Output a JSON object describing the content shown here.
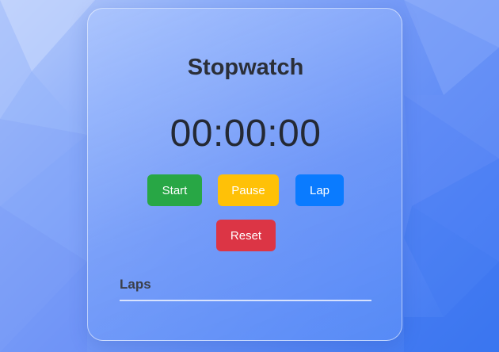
{
  "stopwatch": {
    "title": "Stopwatch",
    "time": "00:00:00"
  },
  "controls": {
    "start_label": "Start",
    "pause_label": "Pause",
    "lap_label": "Lap",
    "reset_label": "Reset"
  },
  "laps": {
    "heading": "Laps",
    "items": []
  },
  "colors": {
    "start": "#28a745",
    "pause": "#ffc107",
    "lap": "#0a7bff",
    "reset": "#dc3545"
  }
}
